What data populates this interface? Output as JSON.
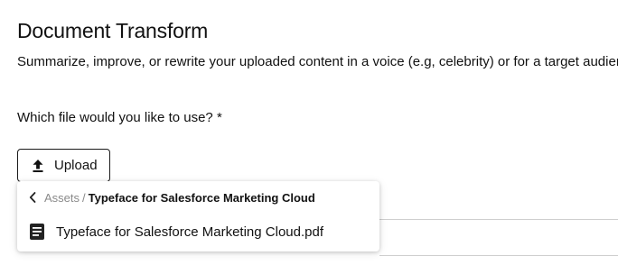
{
  "header": {
    "title": "Document Transform",
    "subtitle": "Summarize, improve, or rewrite your uploaded content in a voice (e.g, celebrity) or for a target audience"
  },
  "form": {
    "question": "Which file would you like to use? *",
    "upload_label": "Upload"
  },
  "picker": {
    "breadcrumb_root": "Assets",
    "breadcrumb_separator": "/",
    "breadcrumb_current": "Typeface for Salesforce Marketing Cloud",
    "files": [
      {
        "name": "Typeface for Salesforce Marketing Cloud.pdf",
        "icon": "document-icon"
      }
    ]
  },
  "icons": {
    "upload": "upload-arrow-icon",
    "back": "chevron-left-icon",
    "file": "document-icon"
  }
}
